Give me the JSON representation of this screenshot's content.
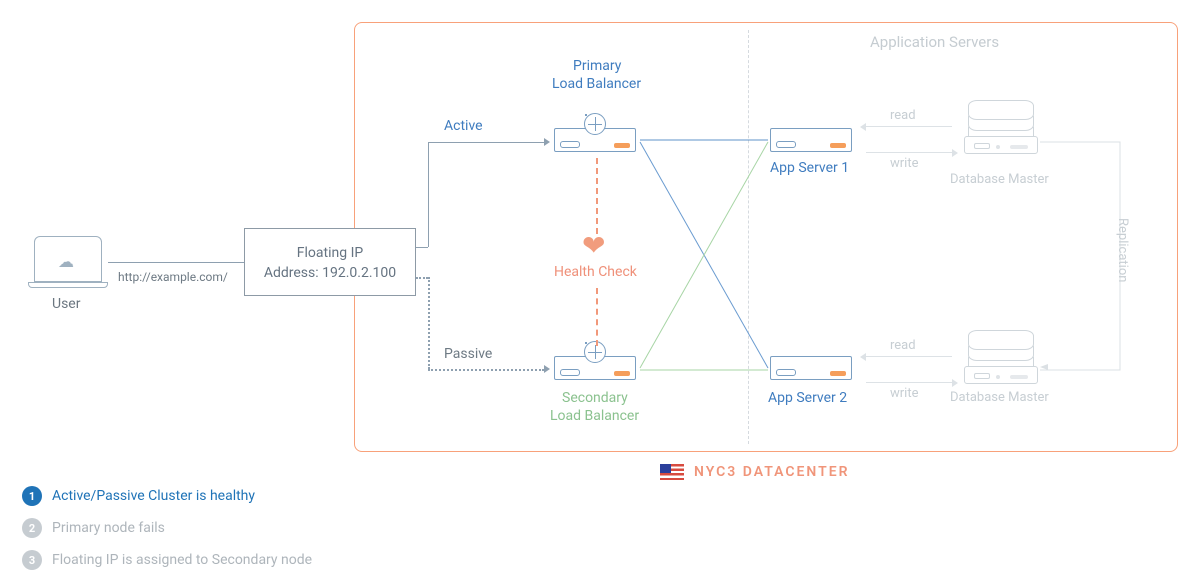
{
  "user": {
    "label": "User"
  },
  "url": "http://example.com/",
  "floating_ip": {
    "line1": "Floating IP",
    "line2": "Address: 192.0.2.100"
  },
  "lb": {
    "active_label": "Active",
    "passive_label": "Passive",
    "primary_title_line1": "Primary",
    "primary_title_line2": "Load Balancer",
    "secondary_title_line1": "Secondary",
    "secondary_title_line2": "Load Balancer",
    "health_check": "Health Check"
  },
  "app": {
    "section_title": "Application Servers",
    "server1": "App Server 1",
    "server2": "App Server 2"
  },
  "db": {
    "label": "Database Master",
    "read": "read",
    "write": "write",
    "replication": "Replication"
  },
  "datacenter": {
    "label": "NYC3 DATACENTER"
  },
  "steps": {
    "s1": {
      "num": "1",
      "text": "Active/Passive Cluster is healthy"
    },
    "s2": {
      "num": "2",
      "text": "Primary node fails"
    },
    "s3": {
      "num": "3",
      "text": "Floating IP is assigned to Secondary node"
    }
  }
}
